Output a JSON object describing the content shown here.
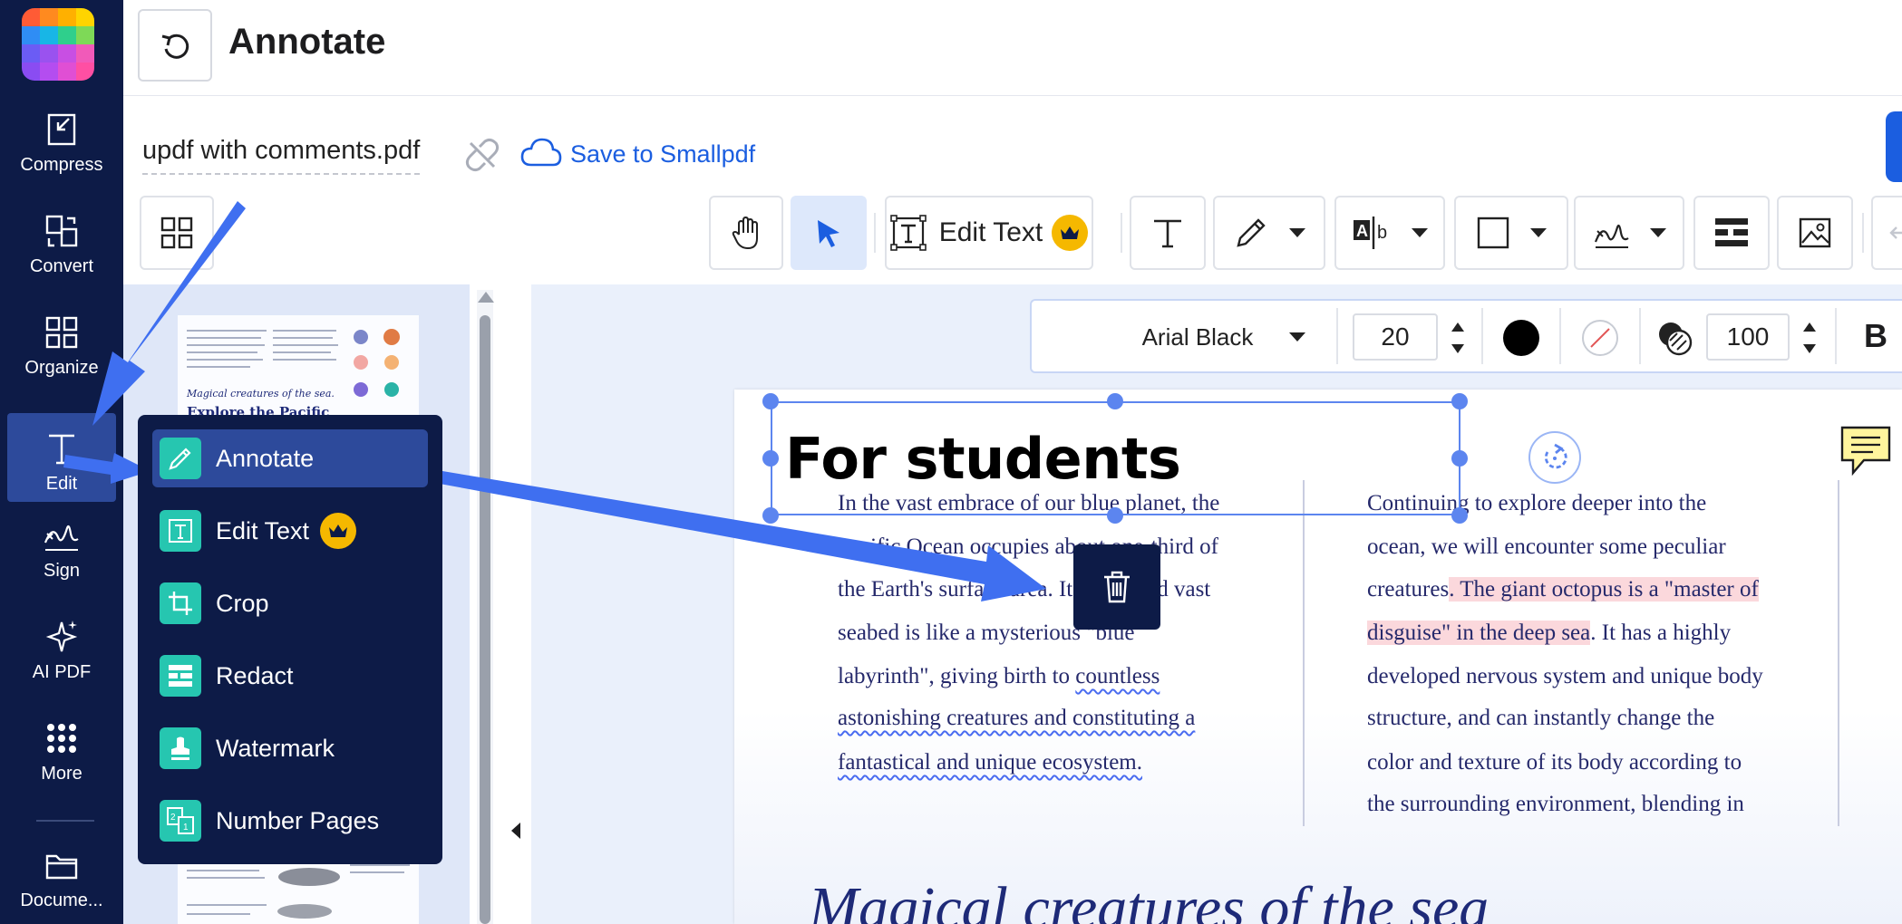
{
  "header": {
    "title": "Annotate"
  },
  "rail": {
    "items": [
      {
        "label": "Compress",
        "icon": "compress-icon"
      },
      {
        "label": "Convert",
        "icon": "convert-icon"
      },
      {
        "label": "Organize",
        "icon": "organize-icon"
      },
      {
        "label": "Edit",
        "icon": "edit-text-icon",
        "active": true
      },
      {
        "label": "Sign",
        "icon": "signature-icon"
      },
      {
        "label": "AI PDF",
        "icon": "sparkles-icon"
      },
      {
        "label": "More",
        "icon": "dots-grid-icon"
      },
      {
        "label": "Docume...",
        "icon": "folder-icon"
      }
    ]
  },
  "file": {
    "name": "updf with comments.pdf",
    "save_label": "Save to Smallpdf"
  },
  "toolbar": {
    "edit_text_label": "Edit Text"
  },
  "format": {
    "font": "Arial Black",
    "size": "20",
    "opacity": "100",
    "bold_label": "B",
    "text_color": "#000000"
  },
  "document": {
    "heading": "For students",
    "col1": [
      "In the vast embrace of our blue planet, the",
      "Pacific Ocean occupies about one-third of",
      "the Earth's surface area. Its deep and vast",
      "seabed is like a mysterious \"blue",
      "labyrinth\", giving birth to ",
      "countless",
      "astonishing creatures and constituting a",
      "fantastical and unique ecosystem."
    ],
    "col2": [
      "Continuing to explore deeper into the",
      "ocean, we will encounter some peculiar",
      "creatures",
      ". The giant octopus is a \"master of",
      "disguise\" in the deep sea",
      ". It has a highly",
      "developed nervous system and unique body",
      "structure, and can instantly change the",
      "color and texture of its body according to",
      "the surrounding environment, blending in"
    ],
    "subheading": "Magical creatures of the sea"
  },
  "thumbnail": {
    "caption": "Magical creatures of the sea.",
    "title": "Explore the Pacific"
  },
  "menu": {
    "items": [
      {
        "label": "Annotate",
        "icon": "pencil-icon",
        "active": true
      },
      {
        "label": "Edit Text",
        "icon": "edit-text-icon",
        "premium": true
      },
      {
        "label": "Crop",
        "icon": "crop-icon"
      },
      {
        "label": "Redact",
        "icon": "redact-icon"
      },
      {
        "label": "Watermark",
        "icon": "stamp-icon"
      },
      {
        "label": "Number Pages",
        "icon": "number-pages-icon"
      }
    ]
  },
  "colors": {
    "rail_bg": "#0d1b47",
    "accent": "#1b5ee0",
    "menu_icon": "#26c6b0",
    "highlight": "#fbd8dc",
    "arrow": "#3f6ff0",
    "premium": "#f5b800"
  }
}
